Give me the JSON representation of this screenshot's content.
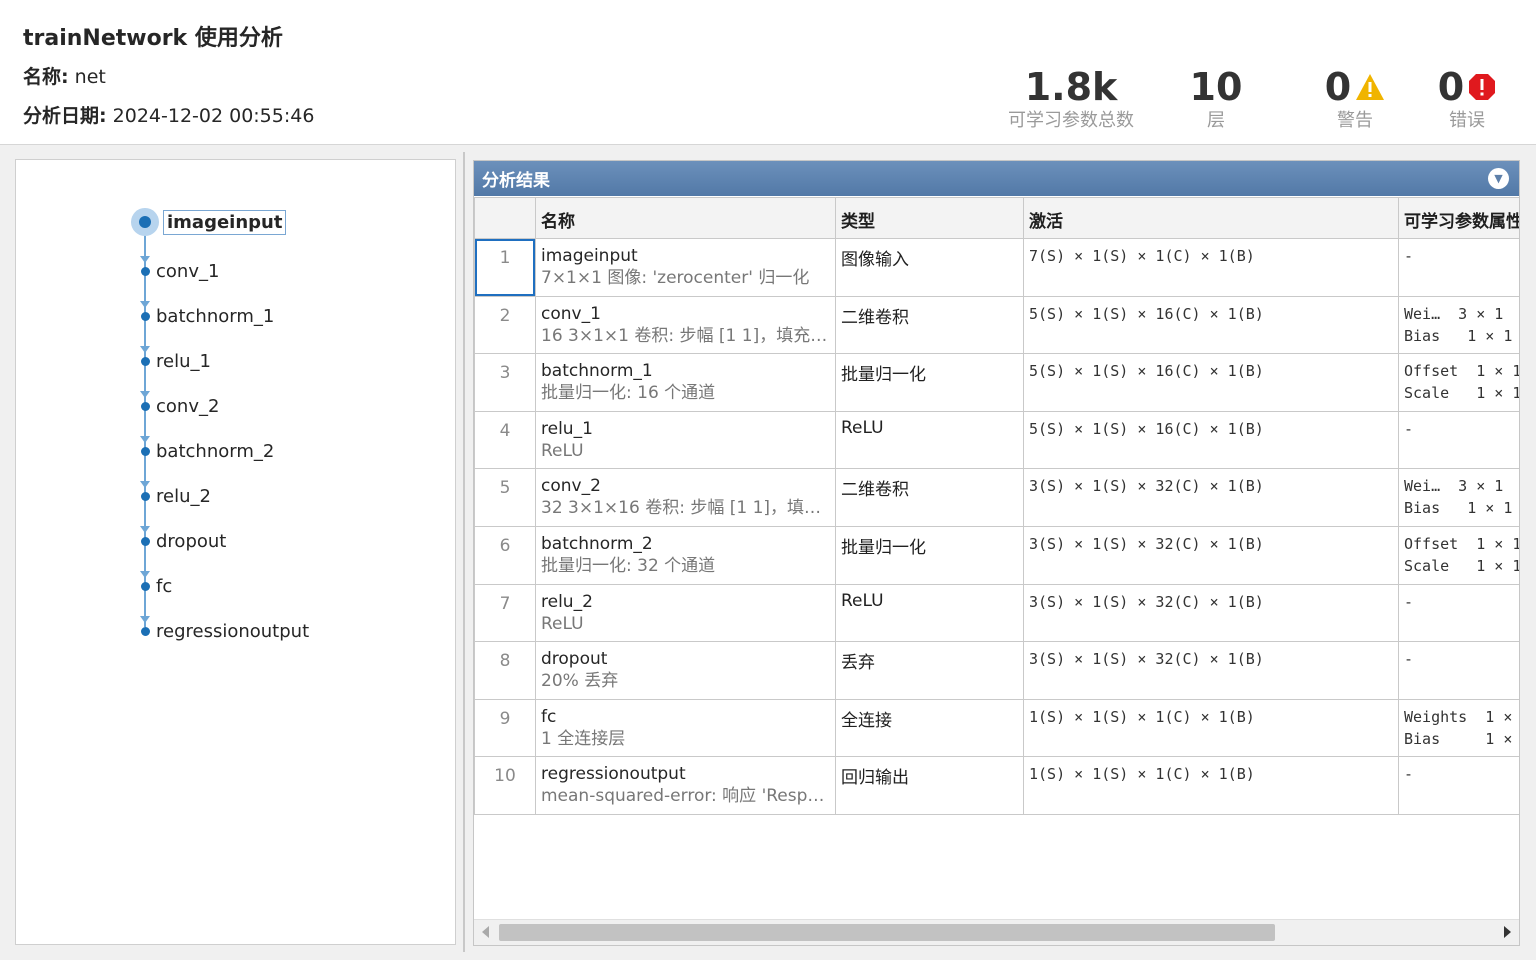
{
  "header": {
    "title": "trainNetwork 使用分析",
    "name_label": "名称:",
    "name_value": " net",
    "date_label": "分析日期:",
    "date_value": " 2024-12-02 00:55:46"
  },
  "stats": {
    "params": {
      "value": "1.8k",
      "label": "可学习参数总数"
    },
    "layers": {
      "value": "10",
      "label": "层"
    },
    "warnings": {
      "value": "0",
      "label": "警告"
    },
    "errors": {
      "value": "0",
      "label": "错误"
    }
  },
  "colors": {
    "accent": "#1b6fb5",
    "header_bar": "#5a7fac",
    "warning": "#f0b400",
    "error": "#e0191e"
  },
  "graph": {
    "nodes": [
      "imageinput",
      "conv_1",
      "batchnorm_1",
      "relu_1",
      "conv_2",
      "batchnorm_2",
      "relu_2",
      "dropout",
      "fc",
      "regressionoutput"
    ],
    "selected": "imageinput"
  },
  "results": {
    "title": "分析结果",
    "columns": [
      "",
      "名称",
      "类型",
      "激活",
      "可学习参数属性"
    ],
    "rows": [
      {
        "index": "1",
        "name": "imageinput",
        "desc": "7×1×1 图像: 'zerocenter' 归一化",
        "type": "图像输入",
        "activation": "7(S) × 1(S) × 1(C) × 1(B)",
        "params": [
          "-"
        ]
      },
      {
        "index": "2",
        "name": "conv_1",
        "desc": "16 3×1×1 卷积: 步幅 [1 1]，填充 [...",
        "type": "二维卷积",
        "activation": "5(S) × 1(S) × 16(C) × 1(B)",
        "params": [
          "Wei…  3 × 1",
          "Bias   1 × 1"
        ]
      },
      {
        "index": "3",
        "name": "batchnorm_1",
        "desc": "批量归一化: 16 个通道",
        "type": "批量归一化",
        "activation": "5(S) × 1(S) × 16(C) × 1(B)",
        "params": [
          "Offset  1 × 1",
          "Scale   1 × 1"
        ]
      },
      {
        "index": "4",
        "name": "relu_1",
        "desc": "ReLU",
        "type": "ReLU",
        "activation": "5(S) × 1(S) × 16(C) × 1(B)",
        "params": [
          "-"
        ]
      },
      {
        "index": "5",
        "name": "conv_2",
        "desc": "32 3×1×16 卷积: 步幅 [1 1]，填充 ...",
        "type": "二维卷积",
        "activation": "3(S) × 1(S) × 32(C) × 1(B)",
        "params": [
          "Wei…  3 × 1",
          "Bias   1 × 1"
        ]
      },
      {
        "index": "6",
        "name": "batchnorm_2",
        "desc": "批量归一化: 32 个通道",
        "type": "批量归一化",
        "activation": "3(S) × 1(S) × 32(C) × 1(B)",
        "params": [
          "Offset  1 × 1",
          "Scale   1 × 1"
        ]
      },
      {
        "index": "7",
        "name": "relu_2",
        "desc": "ReLU",
        "type": "ReLU",
        "activation": "3(S) × 1(S) × 32(C) × 1(B)",
        "params": [
          "-"
        ]
      },
      {
        "index": "8",
        "name": "dropout",
        "desc": "20% 丢弃",
        "type": "丢弃",
        "activation": "3(S) × 1(S) × 32(C) × 1(B)",
        "params": [
          "-"
        ]
      },
      {
        "index": "9",
        "name": "fc",
        "desc": "1 全连接层",
        "type": "全连接",
        "activation": "1(S) × 1(S) × 1(C) × 1(B)",
        "params": [
          "Weights  1 ×",
          "Bias     1 ×"
        ]
      },
      {
        "index": "10",
        "name": "regressionoutput",
        "desc": "mean-squared-error: 响应 'Respon...",
        "type": "回归输出",
        "activation": "1(S) × 1(S) × 1(C) × 1(B)",
        "params": [
          "-"
        ]
      }
    ]
  }
}
